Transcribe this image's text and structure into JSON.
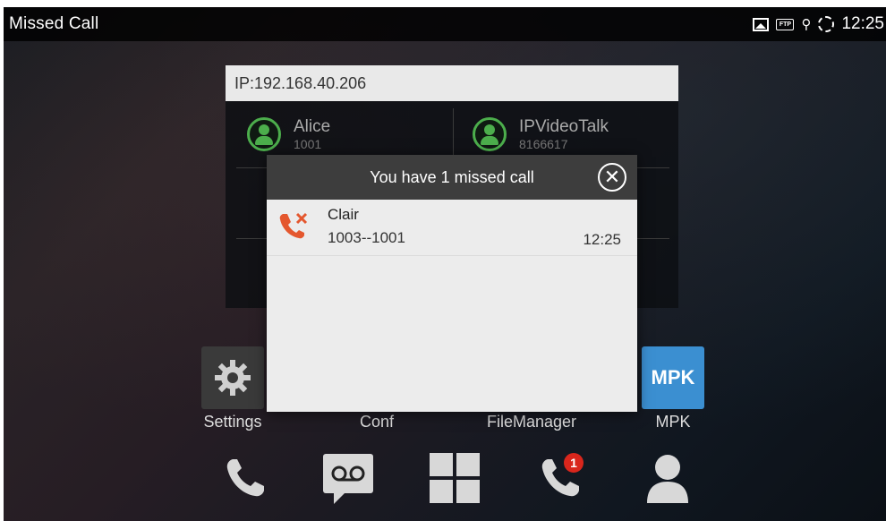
{
  "status_bar": {
    "title": "Missed Call",
    "time": "12:25",
    "icons": [
      "gallery-icon",
      "ftp-icon",
      "usb-icon",
      "sync-icon"
    ]
  },
  "account_panel": {
    "ip": "IP:192.168.40.206",
    "accounts": [
      {
        "name": "Alice",
        "number": "1001"
      },
      {
        "name": "IPVideoTalk",
        "number": "8166617"
      }
    ]
  },
  "apps": [
    {
      "label": "Settings",
      "icon": "gear-icon"
    },
    {
      "label": "Conf",
      "icon": "conference-icon"
    },
    {
      "label": "FileManager",
      "icon": "folder-icon"
    },
    {
      "label": "MPK",
      "icon": "mpk-icon",
      "tile_text": "MPK"
    }
  ],
  "dock": {
    "items": [
      "phone-icon",
      "voicemail-icon",
      "apps-grid-icon",
      "call-history-icon",
      "contacts-icon"
    ],
    "missed_badge": "1"
  },
  "dialog": {
    "title": "You have 1 missed call",
    "close_icon": "close-icon",
    "calls": [
      {
        "name": "Clair",
        "numbers": "1003--1001",
        "time": "12:25"
      }
    ]
  },
  "colors": {
    "missed_call_red": "#e4572e",
    "account_green": "#4cae4c",
    "mpk_blue": "#3b8fd1",
    "badge_red": "#d9261c"
  }
}
